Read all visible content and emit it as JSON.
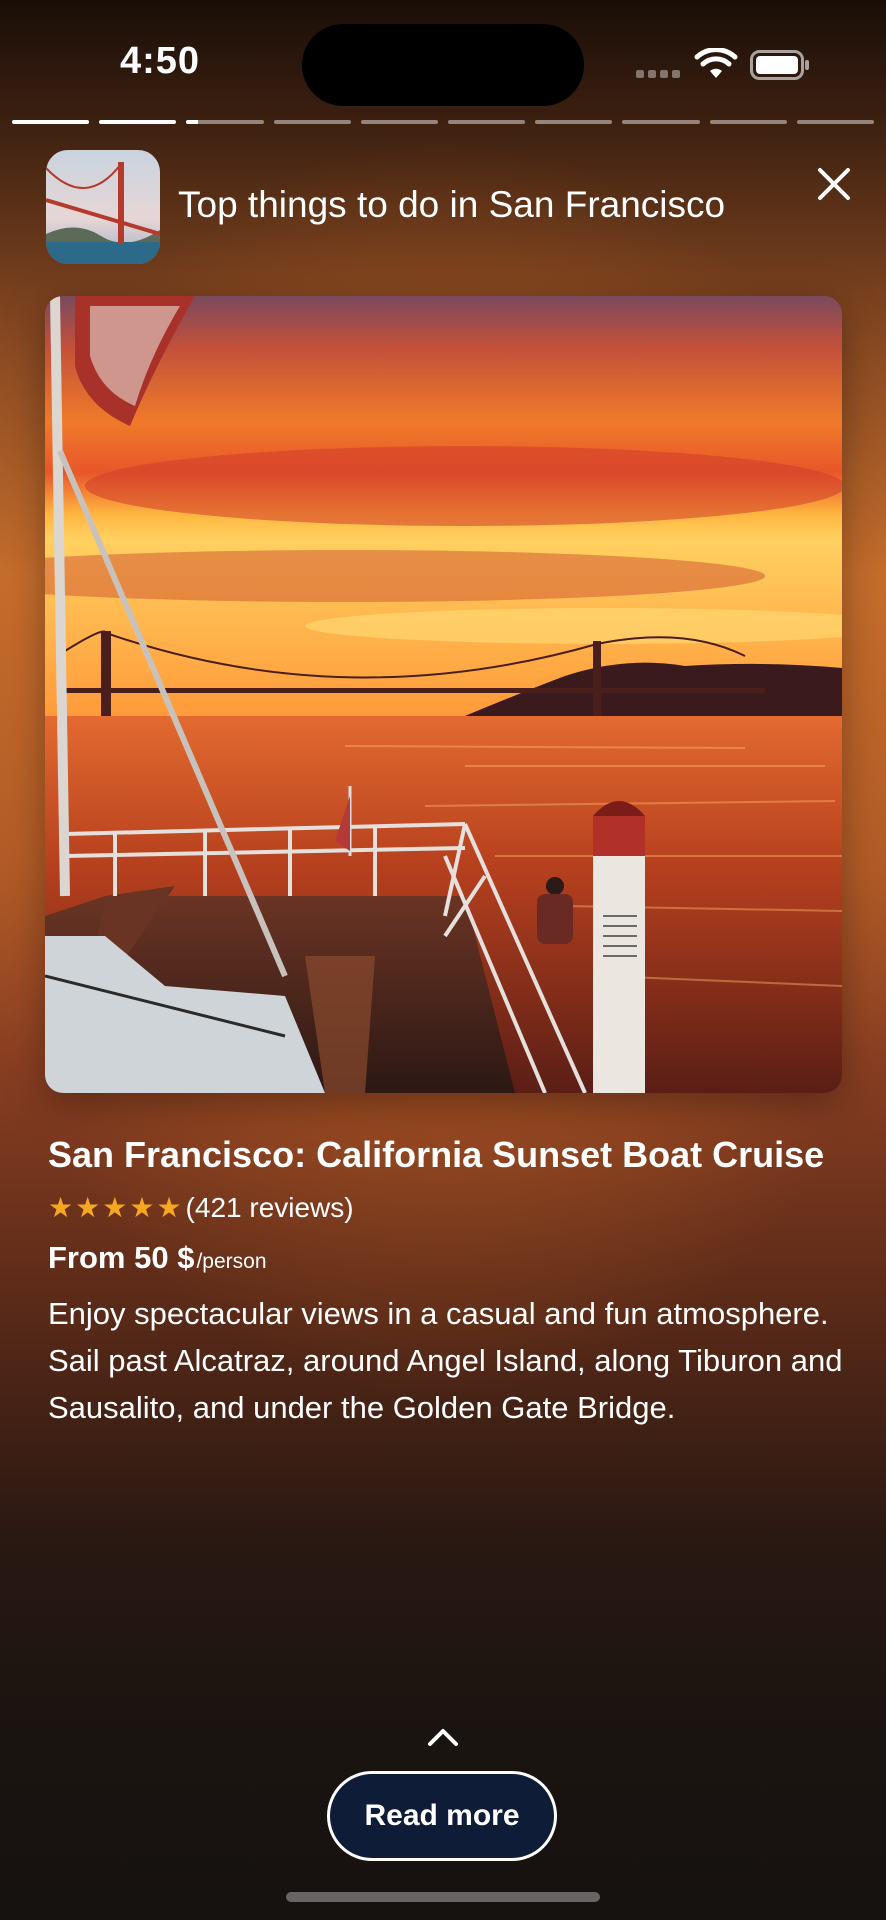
{
  "status_bar": {
    "time": "4:50",
    "icons": [
      "cellular-signal-icon",
      "wifi-icon",
      "battery-icon"
    ]
  },
  "story": {
    "segment_count": 10,
    "current_segment_index": 2,
    "current_segment_progress": 0.15
  },
  "header": {
    "title": "Top things to do in San Francisco",
    "thumbnail": "golden-gate-bridge-thumbnail",
    "close_icon": "close-icon"
  },
  "photo": {
    "subject": "sunset-boat-cruise-photo"
  },
  "listing": {
    "title": "San Francisco: California Sunset Boat Cruise",
    "rating_stars": 5,
    "reviews": "(421 reviews)",
    "price": "From 50 $",
    "price_unit": "/person",
    "description": "Enjoy spectacular views in a casual and fun atmosphere. Sail past Alcatraz, around Angel Island, along Tiburon and Sausalito, and under the Golden Gate Bridge."
  },
  "footer": {
    "chevron_icon": "chevron-up-icon",
    "read_more_label": "Read more"
  },
  "colors": {
    "star": "#f5a623",
    "button_bg": "#0f1c38",
    "accent_orange": "#c46d2c"
  }
}
